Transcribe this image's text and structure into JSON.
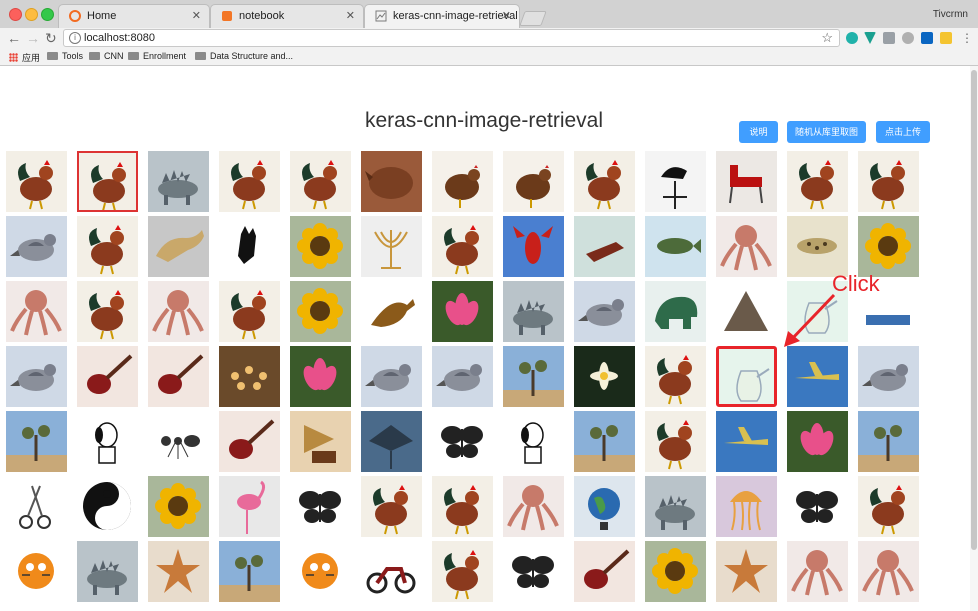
{
  "browser": {
    "tabs": [
      {
        "label": "Home",
        "favicon_color": "#f26b21"
      },
      {
        "label": "notebook",
        "favicon_color": "#f37626"
      },
      {
        "label": "keras-cnn-image-retrieval",
        "favicon_color": "#7a7a7a",
        "active": true
      }
    ],
    "profile": "Tivcrmn",
    "url": "localhost:8080",
    "bookmarks": [
      "应用",
      "Tools",
      "CNN",
      "Enrollment",
      "Data Structure and..."
    ]
  },
  "page": {
    "title": "keras-cnn-image-retrieval",
    "buttons": [
      "说明",
      "随机从库里取图",
      "点击上传"
    ],
    "accent": "#409eff",
    "annotation": "Click"
  },
  "grid": {
    "rows": [
      [
        "rooster",
        "rooster",
        "stegosaurus",
        "rooster",
        "rooster",
        "rhino",
        "hen",
        "hen",
        "rooster",
        "weathervane",
        "chair",
        "rooster",
        "rooster"
      ],
      [
        "pigeon",
        "rooster",
        "cougar",
        "glove",
        "sunflower",
        "menorah",
        "rooster",
        "lobster",
        "stapler",
        "bass",
        "octopus",
        "leopard",
        "sunflower"
      ],
      [
        "octopus",
        "rooster",
        "octopus",
        "rooster",
        "sunflower",
        "dinosaur",
        "lotus",
        "stegosaurus",
        "pigeon",
        "elephant",
        "pyramid",
        "ewer",
        "logo"
      ],
      [
        "pigeon",
        "guitar",
        "guitar",
        "chandelier",
        "lotus",
        "pigeon",
        "pigeon",
        "joshua-tree",
        "water-lily",
        "rooster",
        "ewer",
        "airplane",
        "pigeon"
      ],
      [
        "joshua-tree",
        "snoopy",
        "ant",
        "guitar",
        "gramophone",
        "stingray",
        "butterfly",
        "snoopy",
        "joshua-tree",
        "rooster",
        "airplane",
        "lotus",
        "joshua-tree"
      ],
      [
        "scissors",
        "yin-yang",
        "sunflower",
        "flamingo",
        "butterfly",
        "rooster",
        "rooster",
        "octopus",
        "globe",
        "stegosaurus",
        "jellyfish",
        "butterfly",
        "rooster"
      ],
      [
        "garfield",
        "stegosaurus",
        "starfish",
        "joshua-tree",
        "garfield",
        "motorbike",
        "rooster",
        "butterfly",
        "guitar",
        "sunflower",
        "starfish",
        "octopus",
        "octopus"
      ]
    ],
    "selected": [
      0,
      1
    ],
    "clicked": [
      3,
      10
    ]
  }
}
